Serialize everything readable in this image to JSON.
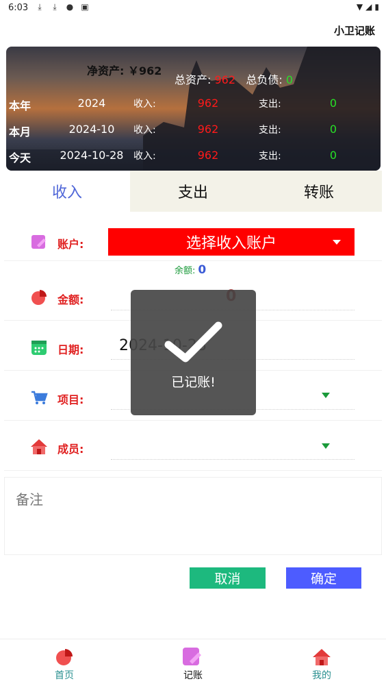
{
  "status_bar": {
    "time": "6:03",
    "left_icons": [
      "download-icon",
      "download-icon",
      "alert-icon",
      "app-icon"
    ],
    "right_icons": [
      "wifi-icon",
      "signal-icon",
      "battery-icon"
    ]
  },
  "app": {
    "title": "小卫记账"
  },
  "summary": {
    "net_assets_label": "净资产:",
    "net_assets_value": "￥962",
    "total_assets_label": "总资产:",
    "total_assets_value": "962",
    "total_liabilities_label": "总负债:",
    "total_liabilities_value": "0",
    "rows": [
      {
        "label": "本年",
        "date": "2024",
        "income_label": "收入:",
        "income": "962",
        "expense_label": "支出:",
        "expense": "0"
      },
      {
        "label": "本月",
        "date": "2024-10",
        "income_label": "收入:",
        "income": "962",
        "expense_label": "支出:",
        "expense": "0"
      },
      {
        "label": "今天",
        "date": "2024-10-28",
        "income_label": "收入:",
        "income": "962",
        "expense_label": "支出:",
        "expense": "0"
      }
    ]
  },
  "tabs": [
    {
      "label": "收入",
      "active": true
    },
    {
      "label": "支出",
      "active": false
    },
    {
      "label": "转账",
      "active": false
    }
  ],
  "form": {
    "account_label": "账户:",
    "account_select": "选择收入账户",
    "balance_label": "余额:",
    "balance_value": "0",
    "amount_label": "金额:",
    "amount_value": "0",
    "date_label": "日期:",
    "date_value": "2024-10-28",
    "item_label": "项目:",
    "member_label": "成员:",
    "note_placeholder": "备注",
    "cancel_label": "取消",
    "confirm_label": "确定"
  },
  "toast": {
    "text": "已记账!"
  },
  "bottom_nav": [
    {
      "label": "首页",
      "icon": "pie-chart-icon"
    },
    {
      "label": "记账",
      "icon": "edit-note-icon",
      "active": true
    },
    {
      "label": "我的",
      "icon": "home-icon"
    }
  ],
  "colors": {
    "accent_blue": "#4f66d8",
    "income_red": "#ff1a1a",
    "expense_green": "#27e127",
    "select_red": "#ff0000",
    "cancel_green": "#1db97e",
    "confirm_blue": "#4d5cff"
  }
}
